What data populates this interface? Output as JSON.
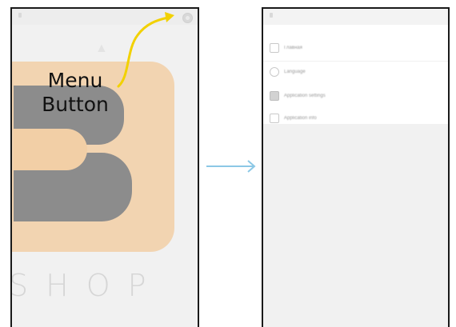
{
  "annotation": {
    "label_line1": "Menu",
    "label_line2": "Button"
  },
  "left_screen": {
    "logo_text": "SHOP",
    "menu_button_icon": "overflow-menu-icon"
  },
  "right_screen": {
    "drawer_items": [
      {
        "icon": "home-icon",
        "label": "Главная"
      },
      {
        "icon": "language-icon",
        "label": "Language"
      },
      {
        "icon": "card-icon",
        "label": "Application settings"
      },
      {
        "icon": "info-icon",
        "label": "Application info"
      }
    ]
  },
  "colors": {
    "logo_orange": "#f2cfa6",
    "logo_gray": "#8c8c8c",
    "arrow_yellow": "#f2d100",
    "flow_arrow_blue": "#8cc8e6"
  }
}
